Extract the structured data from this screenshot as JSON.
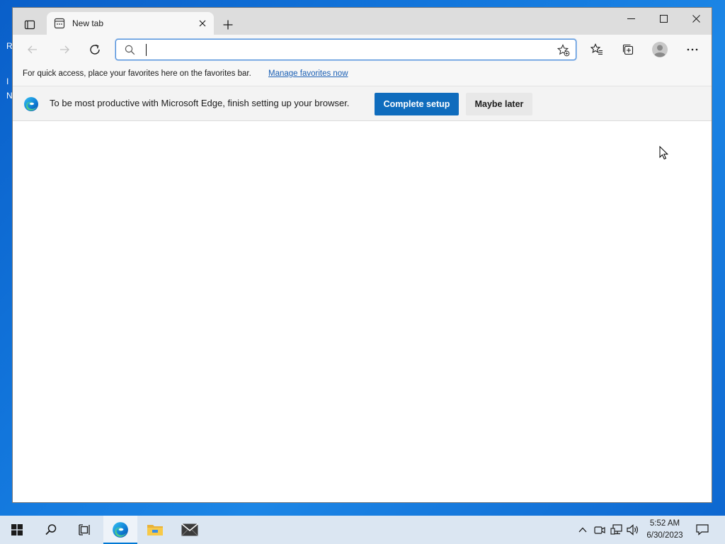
{
  "desktop": {
    "clipped_icon_letters": [
      "R",
      "I",
      "N"
    ]
  },
  "browser": {
    "tab": {
      "title": "New tab",
      "icon": "new-tab-page-icon"
    },
    "address_bar": {
      "value": "",
      "placeholder": ""
    },
    "favorites_bar": {
      "text": "For quick access, place your favorites here on the favorites bar.",
      "link": "Manage favorites now"
    },
    "infobar": {
      "message": "To be most productive with Microsoft Edge, finish setting up your browser.",
      "primary_button": "Complete setup",
      "secondary_button": "Maybe later"
    }
  },
  "taskbar": {
    "items": [
      "windows-start-icon",
      "search-icon",
      "task-view-icon",
      "edge-icon",
      "file-explorer-icon",
      "mail-icon"
    ],
    "clock": {
      "time": "5:52 AM",
      "date": "6/30/2023"
    }
  },
  "colors": {
    "accent": "#0f6cbd",
    "link": "#1a5fb4",
    "desktop": "#1276dc",
    "taskbar": "#dbe6f2"
  }
}
